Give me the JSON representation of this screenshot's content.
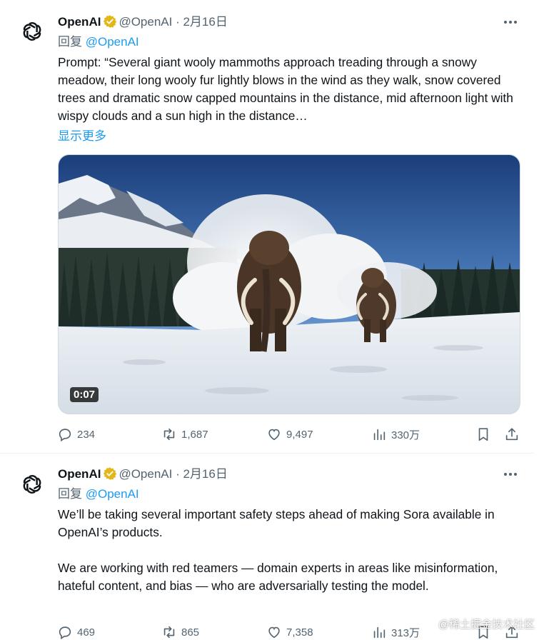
{
  "tweets": [
    {
      "author_name": "OpenAI",
      "handle_date": "@OpenAI · 2月16日",
      "reply_prefix": "回复",
      "reply_mention": "@OpenAI",
      "body": "Prompt: “Several giant wooly mammoths approach treading through a snowy meadow, their long wooly fur lightly blows in the wind as they walk, snow covered trees and dramatic snow capped mountains in the distance, mid afternoon light with wispy clouds and a sun high in the distance…",
      "show_more": "显示更多",
      "video_duration": "0:07",
      "replies": "234",
      "reposts": "1,687",
      "likes": "9,497",
      "views": "330万"
    },
    {
      "author_name": "OpenAI",
      "handle_date": "@OpenAI · 2月16日",
      "reply_prefix": "回复",
      "reply_mention": "@OpenAI",
      "paragraph1": "We’ll be taking several important safety steps ahead of making Sora available in OpenAI’s products.",
      "paragraph2": "We are working with red teamers — domain experts in areas like misinformation, hateful content, and bias — who are adversarially testing the model.",
      "replies": "469",
      "reposts": "865",
      "likes": "7,358",
      "views": "313万"
    }
  ],
  "watermark": "@稀土掘金技术社区",
  "colors": {
    "accent": "#1d9bf0",
    "verified": "#e2b719",
    "muted": "#536471",
    "text": "#0f1419"
  },
  "icons": [
    "openai-logo-icon",
    "verified-badge-icon",
    "more-icon",
    "reply-icon",
    "repost-icon",
    "like-icon",
    "views-icon",
    "bookmark-icon",
    "share-icon"
  ]
}
